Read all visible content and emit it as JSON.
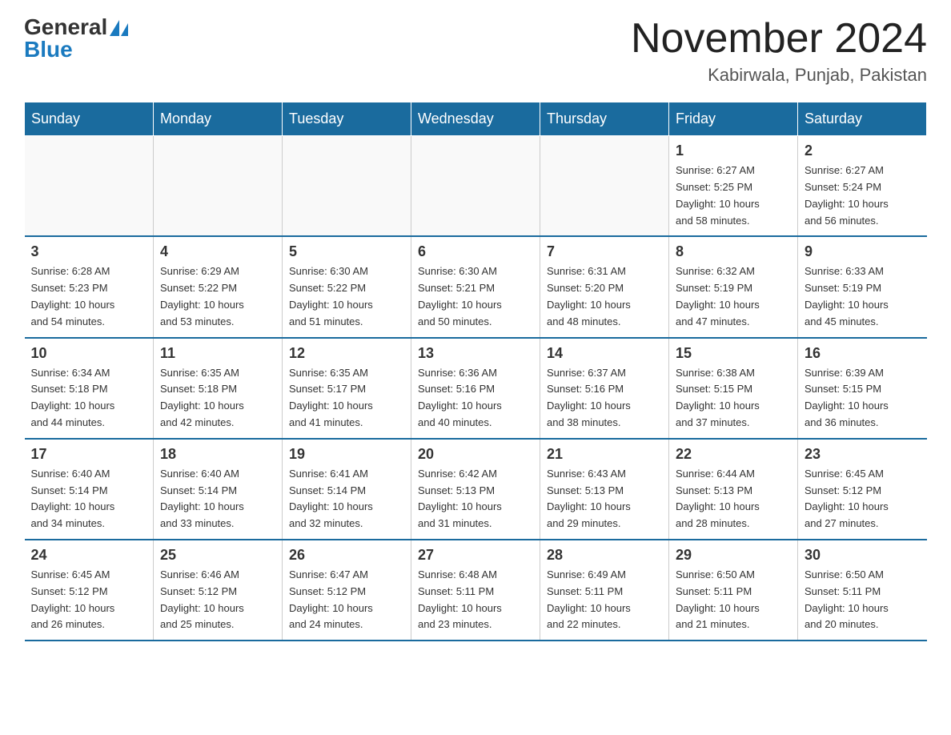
{
  "header": {
    "logo_general": "General",
    "logo_blue": "Blue",
    "month_title": "November 2024",
    "location": "Kabirwala, Punjab, Pakistan"
  },
  "calendar": {
    "days_of_week": [
      "Sunday",
      "Monday",
      "Tuesday",
      "Wednesday",
      "Thursday",
      "Friday",
      "Saturday"
    ],
    "weeks": [
      [
        {
          "day": "",
          "info": ""
        },
        {
          "day": "",
          "info": ""
        },
        {
          "day": "",
          "info": ""
        },
        {
          "day": "",
          "info": ""
        },
        {
          "day": "",
          "info": ""
        },
        {
          "day": "1",
          "info": "Sunrise: 6:27 AM\nSunset: 5:25 PM\nDaylight: 10 hours\nand 58 minutes."
        },
        {
          "day": "2",
          "info": "Sunrise: 6:27 AM\nSunset: 5:24 PM\nDaylight: 10 hours\nand 56 minutes."
        }
      ],
      [
        {
          "day": "3",
          "info": "Sunrise: 6:28 AM\nSunset: 5:23 PM\nDaylight: 10 hours\nand 54 minutes."
        },
        {
          "day": "4",
          "info": "Sunrise: 6:29 AM\nSunset: 5:22 PM\nDaylight: 10 hours\nand 53 minutes."
        },
        {
          "day": "5",
          "info": "Sunrise: 6:30 AM\nSunset: 5:22 PM\nDaylight: 10 hours\nand 51 minutes."
        },
        {
          "day": "6",
          "info": "Sunrise: 6:30 AM\nSunset: 5:21 PM\nDaylight: 10 hours\nand 50 minutes."
        },
        {
          "day": "7",
          "info": "Sunrise: 6:31 AM\nSunset: 5:20 PM\nDaylight: 10 hours\nand 48 minutes."
        },
        {
          "day": "8",
          "info": "Sunrise: 6:32 AM\nSunset: 5:19 PM\nDaylight: 10 hours\nand 47 minutes."
        },
        {
          "day": "9",
          "info": "Sunrise: 6:33 AM\nSunset: 5:19 PM\nDaylight: 10 hours\nand 45 minutes."
        }
      ],
      [
        {
          "day": "10",
          "info": "Sunrise: 6:34 AM\nSunset: 5:18 PM\nDaylight: 10 hours\nand 44 minutes."
        },
        {
          "day": "11",
          "info": "Sunrise: 6:35 AM\nSunset: 5:18 PM\nDaylight: 10 hours\nand 42 minutes."
        },
        {
          "day": "12",
          "info": "Sunrise: 6:35 AM\nSunset: 5:17 PM\nDaylight: 10 hours\nand 41 minutes."
        },
        {
          "day": "13",
          "info": "Sunrise: 6:36 AM\nSunset: 5:16 PM\nDaylight: 10 hours\nand 40 minutes."
        },
        {
          "day": "14",
          "info": "Sunrise: 6:37 AM\nSunset: 5:16 PM\nDaylight: 10 hours\nand 38 minutes."
        },
        {
          "day": "15",
          "info": "Sunrise: 6:38 AM\nSunset: 5:15 PM\nDaylight: 10 hours\nand 37 minutes."
        },
        {
          "day": "16",
          "info": "Sunrise: 6:39 AM\nSunset: 5:15 PM\nDaylight: 10 hours\nand 36 minutes."
        }
      ],
      [
        {
          "day": "17",
          "info": "Sunrise: 6:40 AM\nSunset: 5:14 PM\nDaylight: 10 hours\nand 34 minutes."
        },
        {
          "day": "18",
          "info": "Sunrise: 6:40 AM\nSunset: 5:14 PM\nDaylight: 10 hours\nand 33 minutes."
        },
        {
          "day": "19",
          "info": "Sunrise: 6:41 AM\nSunset: 5:14 PM\nDaylight: 10 hours\nand 32 minutes."
        },
        {
          "day": "20",
          "info": "Sunrise: 6:42 AM\nSunset: 5:13 PM\nDaylight: 10 hours\nand 31 minutes."
        },
        {
          "day": "21",
          "info": "Sunrise: 6:43 AM\nSunset: 5:13 PM\nDaylight: 10 hours\nand 29 minutes."
        },
        {
          "day": "22",
          "info": "Sunrise: 6:44 AM\nSunset: 5:13 PM\nDaylight: 10 hours\nand 28 minutes."
        },
        {
          "day": "23",
          "info": "Sunrise: 6:45 AM\nSunset: 5:12 PM\nDaylight: 10 hours\nand 27 minutes."
        }
      ],
      [
        {
          "day": "24",
          "info": "Sunrise: 6:45 AM\nSunset: 5:12 PM\nDaylight: 10 hours\nand 26 minutes."
        },
        {
          "day": "25",
          "info": "Sunrise: 6:46 AM\nSunset: 5:12 PM\nDaylight: 10 hours\nand 25 minutes."
        },
        {
          "day": "26",
          "info": "Sunrise: 6:47 AM\nSunset: 5:12 PM\nDaylight: 10 hours\nand 24 minutes."
        },
        {
          "day": "27",
          "info": "Sunrise: 6:48 AM\nSunset: 5:11 PM\nDaylight: 10 hours\nand 23 minutes."
        },
        {
          "day": "28",
          "info": "Sunrise: 6:49 AM\nSunset: 5:11 PM\nDaylight: 10 hours\nand 22 minutes."
        },
        {
          "day": "29",
          "info": "Sunrise: 6:50 AM\nSunset: 5:11 PM\nDaylight: 10 hours\nand 21 minutes."
        },
        {
          "day": "30",
          "info": "Sunrise: 6:50 AM\nSunset: 5:11 PM\nDaylight: 10 hours\nand 20 minutes."
        }
      ]
    ]
  }
}
